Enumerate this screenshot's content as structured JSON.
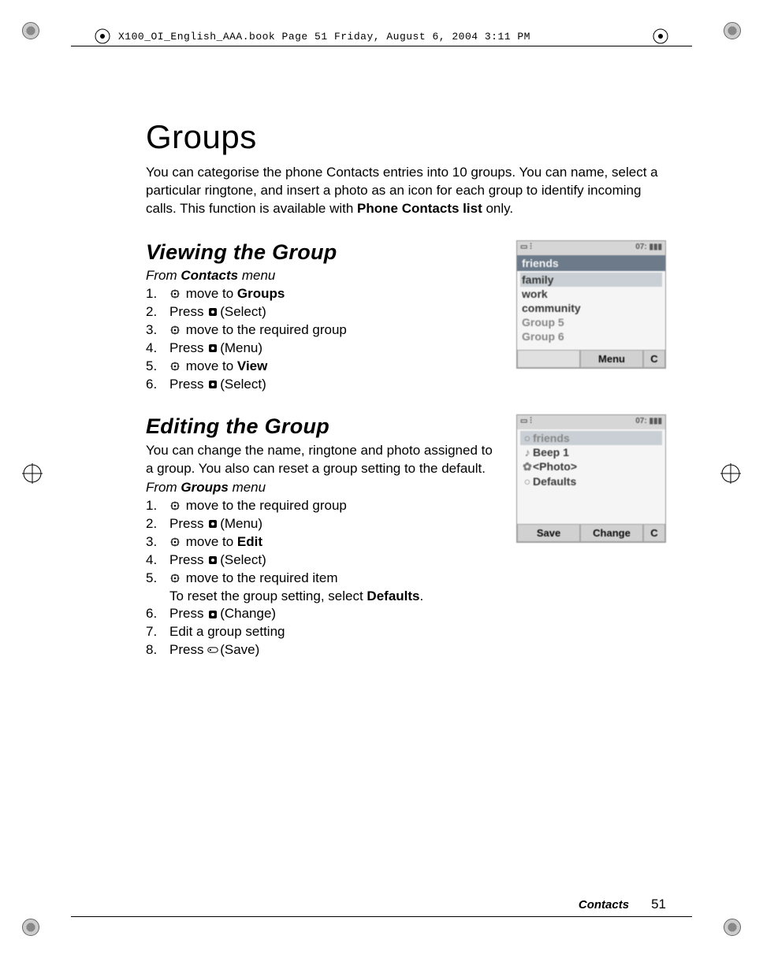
{
  "header": {
    "running_text": "X100_OI_English_AAA.book  Page 51  Friday, August 6, 2004  3:11 PM"
  },
  "page": {
    "title": "Groups",
    "intro_a": "You can categorise the phone Contacts entries into 10 groups. You can name, select a particular ringtone, and insert a photo as an icon for each group to identify incoming calls. This function is available with ",
    "intro_bold": "Phone Contacts list",
    "intro_b": " only."
  },
  "viewing": {
    "heading": "Viewing the Group",
    "from_prefix": "From ",
    "from_bold": "Contacts",
    "from_suffix": " menu",
    "steps": [
      {
        "n": "1.",
        "pre": "",
        "icon": "nav",
        "mid": " move to ",
        "bold": "Groups",
        "post": ""
      },
      {
        "n": "2.",
        "pre": "Press ",
        "icon": "sel",
        "mid": "(Select)",
        "bold": "",
        "post": ""
      },
      {
        "n": "3.",
        "pre": "",
        "icon": "nav",
        "mid": " move to the required group",
        "bold": "",
        "post": ""
      },
      {
        "n": "4.",
        "pre": "Press ",
        "icon": "sel",
        "mid": "(Menu)",
        "bold": "",
        "post": ""
      },
      {
        "n": "5.",
        "pre": "",
        "icon": "nav",
        "mid": " move to ",
        "bold": "View",
        "post": ""
      },
      {
        "n": "6.",
        "pre": "Press ",
        "icon": "sel",
        "mid": "(Select)",
        "bold": "",
        "post": ""
      }
    ],
    "screenshot": {
      "status_left": "▭ ⫶",
      "status_right": "07:  ▮▮▮",
      "title": "friends",
      "rows": [
        {
          "label": "family",
          "sel": true
        },
        {
          "label": "work",
          "sel": false
        },
        {
          "label": "community",
          "sel": false
        },
        {
          "label": "Group 5",
          "sel": false,
          "dim": true
        },
        {
          "label": "Group 6",
          "sel": false,
          "dim": true
        }
      ],
      "soft_left": "",
      "soft_mid": "Menu",
      "soft_right": "C"
    }
  },
  "editing": {
    "heading": "Editing the Group",
    "desc": "You can change the name, ringtone and photo assigned to a group. You also can reset a group setting to the default.",
    "from_prefix": "From ",
    "from_bold": "Groups",
    "from_suffix": " menu",
    "steps": [
      {
        "n": "1.",
        "pre": "",
        "icon": "nav",
        "mid": " move to the required group",
        "bold": "",
        "post": ""
      },
      {
        "n": "2.",
        "pre": "Press ",
        "icon": "sel",
        "mid": "(Menu)",
        "bold": "",
        "post": ""
      },
      {
        "n": "3.",
        "pre": "",
        "icon": "nav",
        "mid": " move to ",
        "bold": "Edit",
        "post": ""
      },
      {
        "n": "4.",
        "pre": "Press ",
        "icon": "sel",
        "mid": "(Select)",
        "bold": "",
        "post": ""
      },
      {
        "n": "5.",
        "pre": "",
        "icon": "nav",
        "mid": " move to the required item",
        "bold": "",
        "post": "",
        "sub_pre": "To reset the group setting, select ",
        "sub_bold": "Defaults",
        "sub_post": "."
      },
      {
        "n": "6.",
        "pre": "Press ",
        "icon": "sel",
        "mid": "(Change)",
        "bold": "",
        "post": ""
      },
      {
        "n": "7.",
        "pre": "Edit a group setting",
        "icon": "",
        "mid": "",
        "bold": "",
        "post": ""
      },
      {
        "n": "8.",
        "pre": "Press ",
        "icon": "save",
        "mid": "(Save)",
        "bold": "",
        "post": ""
      }
    ],
    "screenshot": {
      "status_left": "▭ ⫶",
      "status_right": "07:  ▮▮▮",
      "title": "",
      "rows": [
        {
          "icon": "○",
          "label": "friends",
          "sel": true,
          "dim": true
        },
        {
          "icon": "♪",
          "label": "Beep 1",
          "sel": false
        },
        {
          "icon": "✿",
          "label": "<Photo>",
          "sel": false
        },
        {
          "icon": "○",
          "label": "Defaults",
          "sel": false
        }
      ],
      "soft_left": "Save",
      "soft_mid": "Change",
      "soft_right": "C"
    }
  },
  "footer": {
    "section": "Contacts",
    "page_number": "51"
  }
}
